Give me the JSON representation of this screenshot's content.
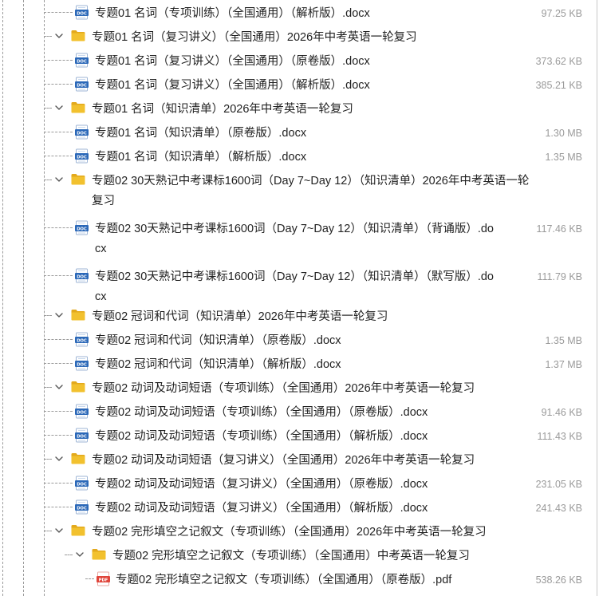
{
  "tree": {
    "rows": [
      {
        "type": "file",
        "icon": "word-document-icon",
        "name": "专题01 名词（专项训练）（全国通用）（解析版）.docx",
        "size": "97.25 KB"
      },
      {
        "type": "folder",
        "icon": "folder-icon",
        "expanded": true,
        "name": "专题01 名词（复习讲义）（全国通用）2026年中考英语一轮复习"
      },
      {
        "type": "file",
        "icon": "word-document-icon",
        "name": "专题01 名词（复习讲义）（全国通用）（原卷版）.docx",
        "size": "373.62 KB"
      },
      {
        "type": "file",
        "icon": "word-document-icon",
        "name": "专题01 名词（复习讲义）（全国通用）（解析版）.docx",
        "size": "385.21 KB"
      },
      {
        "type": "folder",
        "icon": "folder-icon",
        "expanded": true,
        "name": "专题01 名词（知识清单）2026年中考英语一轮复习"
      },
      {
        "type": "file",
        "icon": "word-document-icon",
        "name": "专题01 名词（知识清单）（原卷版）.docx",
        "size": "1.30 MB"
      },
      {
        "type": "file",
        "icon": "word-document-icon",
        "name": "专题01 名词（知识清单）（解析版）.docx",
        "size": "1.35 MB"
      },
      {
        "type": "folder",
        "icon": "folder-icon",
        "expanded": true,
        "name": "专题02 30天熟记中考课标1600词（Day 7~Day 12）（知识清单）2026年中考英语一轮复习"
      },
      {
        "type": "file",
        "icon": "word-document-icon",
        "name": "专题02 30天熟记中考课标1600词（Day 7~Day 12）（知识清单）（背诵版）.docx",
        "size": "117.46 KB"
      },
      {
        "type": "file",
        "icon": "word-document-icon",
        "name": "专题02 30天熟记中考课标1600词（Day 7~Day 12）（知识清单）（默写版）.docx",
        "size": "111.79 KB"
      },
      {
        "type": "folder",
        "icon": "folder-icon",
        "expanded": true,
        "name": "专题02 冠词和代词（知识清单）2026年中考英语一轮复习"
      },
      {
        "type": "file",
        "icon": "word-document-icon",
        "name": "专题02 冠词和代词（知识清单）（原卷版）.docx",
        "size": "1.35 MB"
      },
      {
        "type": "file",
        "icon": "word-document-icon",
        "name": "专题02 冠词和代词（知识清单）（解析版）.docx",
        "size": "1.37 MB"
      },
      {
        "type": "folder",
        "icon": "folder-icon",
        "expanded": true,
        "name": "专题02 动词及动词短语（专项训练）（全国通用）2026年中考英语一轮复习"
      },
      {
        "type": "file",
        "icon": "word-document-icon",
        "name": "专题02 动词及动词短语（专项训练）（全国通用）（原卷版）.docx",
        "size": "91.46 KB"
      },
      {
        "type": "file",
        "icon": "word-document-icon",
        "name": "专题02 动词及动词短语（专项训练）（全国通用）（解析版）.docx",
        "size": "111.43 KB"
      },
      {
        "type": "folder",
        "icon": "folder-icon",
        "expanded": true,
        "name": "专题02 动词及动词短语（复习讲义）（全国通用）2026年中考英语一轮复习"
      },
      {
        "type": "file",
        "icon": "word-document-icon",
        "name": "专题02 动词及动词短语（复习讲义）（全国通用）（原卷版）.docx",
        "size": "231.05 KB"
      },
      {
        "type": "file",
        "icon": "word-document-icon",
        "name": "专题02 动词及动词短语（复习讲义）（全国通用）（解析版）.docx",
        "size": "241.43 KB"
      },
      {
        "type": "folder",
        "icon": "folder-icon",
        "expanded": true,
        "name": "专题02 完形填空之记叙文（专项训练）（全国通用）2026年中考英语一轮复习"
      },
      {
        "type": "folder",
        "icon": "folder-icon",
        "expanded": true,
        "name": "专题02 完形填空之记叙文（专项训练）（全国通用）中考英语一轮复习"
      },
      {
        "type": "file",
        "icon": "pdf-document-icon",
        "name": "专题02 完形填空之记叙文（专项训练）（全国通用）（原卷版）.pdf",
        "size": "538.26 KB"
      }
    ]
  },
  "colors": {
    "folder": "#f2c12e",
    "folder_tab": "#e3a91c",
    "word_blue": "#2b68b8",
    "pdf_red": "#e0443a",
    "size_text": "#9a9a9a",
    "guide_line": "#9a9a9a"
  }
}
